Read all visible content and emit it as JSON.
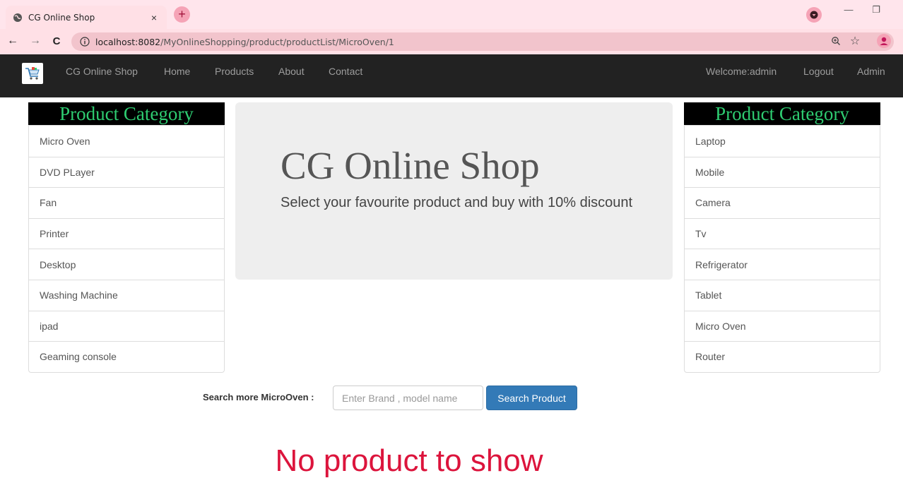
{
  "browser": {
    "tab_title": "CG Online Shop",
    "tab_close": "×",
    "new_tab": "+",
    "url_host": "localhost:8082",
    "url_path": "/MyOnlineShopping/product/productList/MicroOven/1",
    "back": "←",
    "forward": "→",
    "reload": "C",
    "minimize": "—",
    "restore": "❐",
    "star": "☆",
    "accent": "#ffe0e6"
  },
  "navbar": {
    "brand": "CG Online Shop",
    "links": [
      "Home",
      "Products",
      "About",
      "Contact"
    ],
    "welcome": "Welcome:admin",
    "logout": "Logout",
    "admin": "Admin"
  },
  "left_sidebar": {
    "heading": "Product Category",
    "items": [
      "Micro Oven",
      "DVD PLayer",
      "Fan",
      "Printer",
      "Desktop",
      "Washing Machine",
      "ipad",
      "Geaming console"
    ]
  },
  "right_sidebar": {
    "heading": "Product Category",
    "items": [
      "Laptop",
      "Mobile",
      "Camera",
      "Tv",
      "Refrigerator",
      "Tablet",
      "Micro Oven",
      "Router"
    ]
  },
  "jumbotron": {
    "title": "CG Online Shop",
    "subtitle": "Select your favourite product and buy with 10% discount"
  },
  "search": {
    "label": "Search more MicroOven :",
    "placeholder": "Enter Brand , model name",
    "value": "",
    "button": "Search Product"
  },
  "empty_message": "No product to show",
  "colors": {
    "category_heading_text": "#2ecc71",
    "empty_message": "#dc143c",
    "primary_button": "#337ab7",
    "navbar_bg": "#222222"
  }
}
